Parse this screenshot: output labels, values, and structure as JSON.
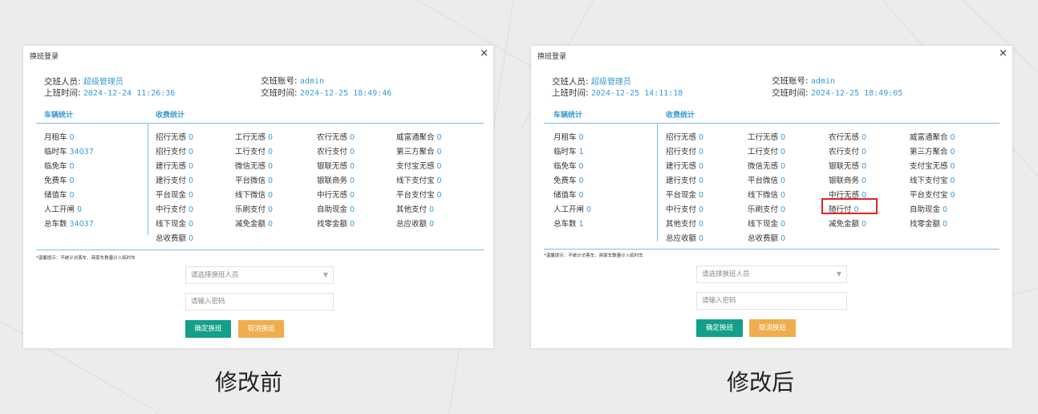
{
  "before": {
    "dialog_title": "换班登录",
    "close": "×",
    "handover_person_label": "交班人员:",
    "handover_person_value": "超级管理员",
    "shift_start_label": "上班时间:",
    "shift_start_value": "2024-12-24 11:26:36",
    "account_label": "交班账号:",
    "account_value": "admin",
    "handover_time_label": "交班时间:",
    "handover_time_value": "2024-12-25 18:49:46",
    "vehicle_stats_title": "车辆统计",
    "fee_stats_title": "收费统计",
    "vehicles": [
      {
        "label": "月租车",
        "value": "0"
      },
      {
        "label": "临时车",
        "value": "34037"
      },
      {
        "label": "临免车",
        "value": "0"
      },
      {
        "label": "免费车",
        "value": "0"
      },
      {
        "label": "储值车",
        "value": "0"
      },
      {
        "label": "人工开闸",
        "value": "0"
      },
      {
        "label": "总车数",
        "value": "34037"
      }
    ],
    "fees": [
      {
        "label": "招行无感",
        "value": "0"
      },
      {
        "label": "工行无感",
        "value": "0"
      },
      {
        "label": "农行无感",
        "value": "0"
      },
      {
        "label": "威富通聚合",
        "value": "0"
      },
      {
        "label": "招行支付",
        "value": "0"
      },
      {
        "label": "工行支付",
        "value": "0"
      },
      {
        "label": "农行支付",
        "value": "0"
      },
      {
        "label": "第三方聚合",
        "value": "0"
      },
      {
        "label": "建行无感",
        "value": "0"
      },
      {
        "label": "微信无感",
        "value": "0"
      },
      {
        "label": "银联无感",
        "value": "0"
      },
      {
        "label": "支付宝无感",
        "value": "0"
      },
      {
        "label": "建行支付",
        "value": "0"
      },
      {
        "label": "平台微信",
        "value": "0"
      },
      {
        "label": "银联商务",
        "value": "0"
      },
      {
        "label": "线下支付宝",
        "value": "0"
      },
      {
        "label": "平台现金",
        "value": "0"
      },
      {
        "label": "线下微信",
        "value": "0"
      },
      {
        "label": "中行无感",
        "value": "0"
      },
      {
        "label": "平台支付宝",
        "value": "0"
      },
      {
        "label": "中行支付",
        "value": "0"
      },
      {
        "label": "乐刷支付",
        "value": "0"
      },
      {
        "label": "自助现金",
        "value": "0"
      },
      {
        "label": "其他支付",
        "value": "0"
      },
      {
        "label": "线下现金",
        "value": "0"
      },
      {
        "label": "减免金额",
        "value": "0"
      },
      {
        "label": "找零金额",
        "value": "0"
      },
      {
        "label": "总应收额",
        "value": "0"
      },
      {
        "label": "总收费额",
        "value": "0"
      }
    ],
    "note": "*温馨提示：不统计访客车、商家车数量计入临时车",
    "select_placeholder": "请选择换班人员",
    "password_placeholder": "请输入密码",
    "confirm_label": "确定换班",
    "cancel_label": "取消换班"
  },
  "after": {
    "dialog_title": "换班登录",
    "close": "×",
    "handover_person_label": "交班人员:",
    "handover_person_value": "超级管理员",
    "shift_start_label": "上班时间:",
    "shift_start_value": "2024-12-25 14:11:18",
    "account_label": "交班账号:",
    "account_value": "admin",
    "handover_time_label": "交班时间:",
    "handover_time_value": "2024-12-25 18:49:05",
    "vehicle_stats_title": "车辆统计",
    "fee_stats_title": "收费统计",
    "vehicles": [
      {
        "label": "月租车",
        "value": "0"
      },
      {
        "label": "临时车",
        "value": "1"
      },
      {
        "label": "临免车",
        "value": "0"
      },
      {
        "label": "免费车",
        "value": "0"
      },
      {
        "label": "储值车",
        "value": "0"
      },
      {
        "label": "人工开闸",
        "value": "0"
      },
      {
        "label": "总车数",
        "value": "1"
      }
    ],
    "fees": [
      {
        "label": "招行无感",
        "value": "0"
      },
      {
        "label": "工行无感",
        "value": "0"
      },
      {
        "label": "农行无感",
        "value": "0"
      },
      {
        "label": "威富通聚合",
        "value": "0"
      },
      {
        "label": "招行支付",
        "value": "0"
      },
      {
        "label": "工行支付",
        "value": "0"
      },
      {
        "label": "农行支付",
        "value": "0"
      },
      {
        "label": "第三方聚合",
        "value": "0"
      },
      {
        "label": "建行无感",
        "value": "0"
      },
      {
        "label": "微信无感",
        "value": "0"
      },
      {
        "label": "银联无感",
        "value": "0"
      },
      {
        "label": "支付宝无感",
        "value": "0"
      },
      {
        "label": "建行支付",
        "value": "0"
      },
      {
        "label": "平台微信",
        "value": "0"
      },
      {
        "label": "银联商务",
        "value": "0"
      },
      {
        "label": "线下支付宝",
        "value": "0"
      },
      {
        "label": "平台现金",
        "value": "0"
      },
      {
        "label": "线下微信",
        "value": "0"
      },
      {
        "label": "中行无感",
        "value": "0"
      },
      {
        "label": "平台支付宝",
        "value": "0"
      },
      {
        "label": "中行支付",
        "value": "0"
      },
      {
        "label": "乐刷支付",
        "value": "0"
      },
      {
        "label": "随行付",
        "value": "0"
      },
      {
        "label": "自助现金",
        "value": "0"
      },
      {
        "label": "其他支付",
        "value": "0"
      },
      {
        "label": "线下现金",
        "value": "0"
      },
      {
        "label": "减免金额",
        "value": "0"
      },
      {
        "label": "找零金额",
        "value": "0"
      },
      {
        "label": "总应收额",
        "value": "0"
      },
      {
        "label": "总收费额",
        "value": "0"
      }
    ],
    "highlighted_item": "随行付",
    "note": "*温馨提示：不统计访客车、商家车数量计入临时车",
    "select_placeholder": "请选择换班人员",
    "password_placeholder": "请输入密码",
    "confirm_label": "确定换班",
    "cancel_label": "取消换班"
  },
  "captions": {
    "before": "修改前",
    "after": "修改后"
  },
  "colors": {
    "accent": "#3a9bd5",
    "confirm": "#149f8a",
    "cancel": "#f0ad4e",
    "highlight": "#e02424"
  }
}
